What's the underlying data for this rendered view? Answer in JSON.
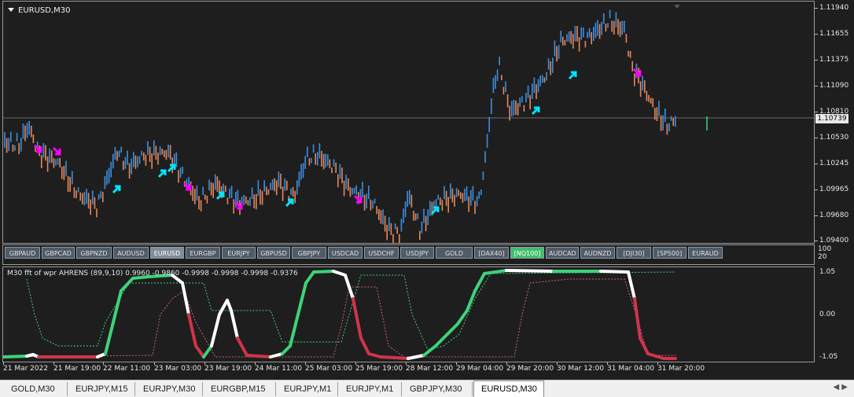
{
  "chart": {
    "title": "EURUSD,M30",
    "current_price": "1.10739",
    "price_ticks": [
      "1.11940",
      "1.11655",
      "1.11375",
      "1.11090",
      "1.10810",
      "1.10530",
      "1.10245",
      "1.09965",
      "1.09680",
      "1.09400"
    ],
    "colors": {
      "up_bar": "#3b8fe0",
      "down_bar": "#e8875a",
      "buy_arrow": "#00e5ff",
      "sell_arrow": "#ff00ff",
      "green_line": "#3fd27a",
      "red_line": "#d0344a",
      "white_line": "#ffffff"
    }
  },
  "symbols": [
    {
      "label": "GBPAUD",
      "state": "normal"
    },
    {
      "label": "GBPCAD",
      "state": "normal"
    },
    {
      "label": "GBPNZD",
      "state": "normal"
    },
    {
      "label": "AUDUSD",
      "state": "normal"
    },
    {
      "label": "EURUSD",
      "state": "active"
    },
    {
      "label": "EURGBP",
      "state": "normal"
    },
    {
      "label": "EURJPY",
      "state": "normal"
    },
    {
      "label": "GBPUSD",
      "state": "normal"
    },
    {
      "label": "GBPJPY",
      "state": "normal"
    },
    {
      "label": "USDCAD",
      "state": "normal"
    },
    {
      "label": "USDCHF",
      "state": "normal"
    },
    {
      "label": "USDJPY",
      "state": "normal"
    },
    {
      "label": "GOLD",
      "state": "normal"
    },
    {
      "label": "[DAX40]",
      "state": "normal"
    },
    {
      "label": "[NQ100]",
      "state": "green"
    },
    {
      "label": "AUDCAD",
      "state": "normal"
    },
    {
      "label": "AUDNZD",
      "state": "normal"
    },
    {
      "label": "[DJI30]",
      "state": "normal"
    },
    {
      "label": "[SP500]",
      "state": "normal"
    },
    {
      "label": "EURAUD",
      "state": "normal"
    }
  ],
  "mid_axis": [
    "100",
    "20"
  ],
  "indicator": {
    "title": "M30 fft of wpr AHRENS (89,9,10) 0.9960 -0.9860 -0.9998 -0.9998 -0.9998 -0.9376",
    "ticks": [
      "1.05",
      "0.00",
      "-1.05"
    ]
  },
  "time_ticks": [
    "21 Mar 2022",
    "21 Mar 19:00",
    "22 Mar 11:00",
    "23 Mar 03:00",
    "23 Mar 19:00",
    "24 Mar 11:00",
    "25 Mar 03:00",
    "25 Mar 19:00",
    "28 Mar 12:00",
    "29 Mar 04:00",
    "29 Mar 20:00",
    "30 Mar 12:00",
    "31 Mar 04:00",
    "31 Mar 20:00"
  ],
  "tabs": [
    {
      "label": "GOLD,M30",
      "active": false
    },
    {
      "label": "EURJPY,M15",
      "active": false
    },
    {
      "label": "EURJPY,M30",
      "active": false
    },
    {
      "label": "EURGBP,M15",
      "active": false
    },
    {
      "label": "EURJPY,M1",
      "active": false
    },
    {
      "label": "EURJPY,M1",
      "active": false
    },
    {
      "label": "GBPJPY,M30",
      "active": false
    },
    {
      "label": "EURUSD,M30",
      "active": true
    }
  ]
}
